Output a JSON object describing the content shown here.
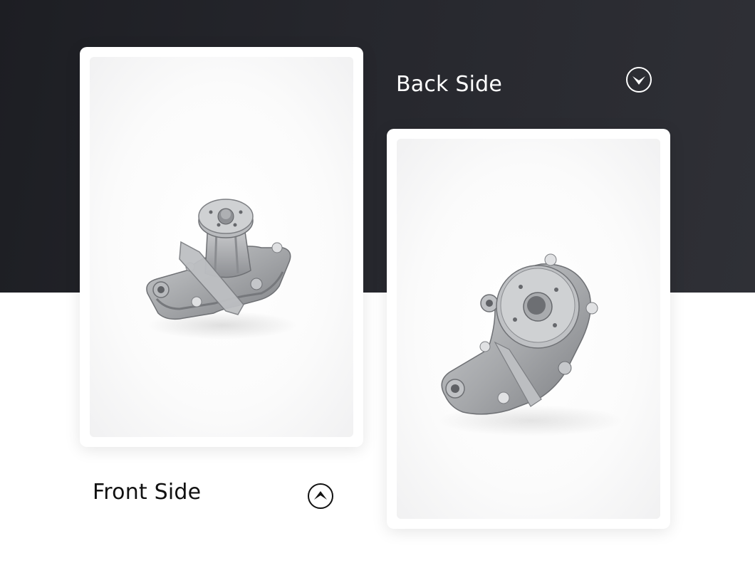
{
  "back": {
    "label": "Back Side",
    "icon": "chevron-down-circle-icon"
  },
  "front": {
    "label": "Front Side",
    "icon": "chevron-up-circle-icon"
  },
  "colors": {
    "dark_band": "#25262c",
    "card": "#ffffff",
    "metal": "#a7a9ac"
  }
}
